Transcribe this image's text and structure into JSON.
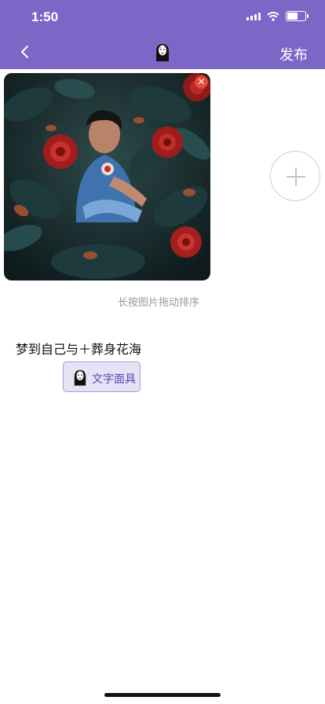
{
  "status_bar": {
    "time": "1:50",
    "battery_level": 0.55
  },
  "nav": {
    "back_icon": "chevron-left-icon",
    "logo_icon": "no-face-mask-icon",
    "publish_label": "发布"
  },
  "colors": {
    "header": "#7c67c6",
    "tag_bg": "#e6e2f6",
    "tag_text": "#5b48b5",
    "remove_badge": "#e8473a"
  },
  "photos": {
    "remove_icon": "close-icon",
    "add_icon": "plus-icon",
    "hint": "长按图片拖动排序"
  },
  "post": {
    "text": "梦到自己与＋葬身花海"
  },
  "tag": {
    "icon": "no-face-mask-icon",
    "label": "文字面具"
  }
}
